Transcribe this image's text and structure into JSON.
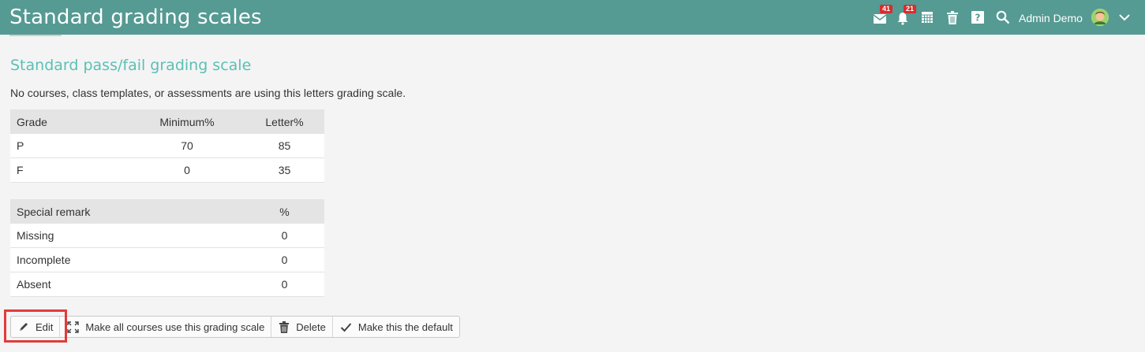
{
  "header": {
    "title": "Standard grading scales",
    "messages_badge": "41",
    "notifications_badge": "21",
    "user_name": "Admin Demo",
    "bar_color": "#559a93"
  },
  "scale": {
    "title": "Standard pass/fail grading scale",
    "usage_note": "No courses, class templates, or assessments are using this letters grading scale."
  },
  "grades_table": {
    "headers": [
      "Grade",
      "Minimum%",
      "Letter%"
    ],
    "rows": [
      [
        "P",
        "70",
        "85"
      ],
      [
        "F",
        "0",
        "35"
      ]
    ]
  },
  "remarks_table": {
    "headers": [
      "Special remark",
      "%"
    ],
    "rows": [
      [
        "Missing",
        "0"
      ],
      [
        "Incomplete",
        "0"
      ],
      [
        "Absent",
        "0"
      ]
    ]
  },
  "toolbar": {
    "edit_label": "Edit",
    "apply_all_label": "Make all courses use this grading scale",
    "delete_label": "Delete",
    "default_label": "Make this the default"
  },
  "icons": [
    "mail-icon",
    "bell-icon",
    "calendar-icon",
    "trash-icon",
    "help-icon",
    "search-icon",
    "chevron-down-icon",
    "pencil-icon",
    "expand-icon",
    "check-icon"
  ],
  "colors": {
    "accent": "#5ac0b6",
    "highlight": "#e23b3b",
    "badge": "#d72c2c"
  }
}
